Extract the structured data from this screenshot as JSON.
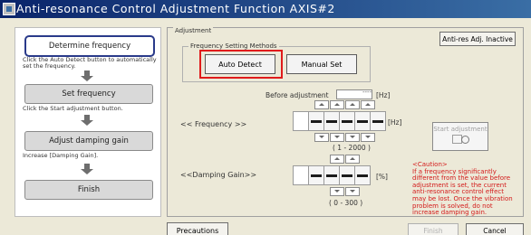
{
  "window": {
    "title": "Anti-resonance Control Adjustment Function AXIS#2"
  },
  "flow": {
    "steps": [
      {
        "label": "Determine frequency",
        "description": "Click the Auto Detect button to automatically set the frequency."
      },
      {
        "label": "Set frequency",
        "description": "Click the Start adjustment button."
      },
      {
        "label": "Adjust damping gain",
        "description": "Increase [Damping Gain]."
      },
      {
        "label": "Finish"
      }
    ]
  },
  "adjustment": {
    "group_title": "Adjustment",
    "status_button": "Anti-res Adj. Inactive",
    "methods_title": "Frequency Setting Methods",
    "auto_detect": "Auto Detect",
    "manual_set": "Manual Set",
    "before_label": "Before adjustment",
    "before_value": "----",
    "before_unit": "[Hz]",
    "frequency_label": "<< Frequency >>",
    "frequency_unit": "[Hz]",
    "frequency_range": "( 1 - 2000 )",
    "damping_label": "<<Damping Gain>>",
    "damping_unit": "[%]",
    "damping_range": "( 0 - 300 )",
    "start_button": "Start adjustment",
    "caution_title": "<Caution>",
    "caution_text": "If a frequency significantly different from the value before adjustment is set, the current anti-resonance control effect may be lost. Once the vibration problem is solved, do not increase damping gain."
  },
  "footer": {
    "precautions": "Precautions",
    "finish": "Finish",
    "cancel": "Cancel"
  },
  "colors": {
    "highlight": "#e01b1b",
    "caution": "#d31919",
    "title_bar": "#0a246a"
  }
}
